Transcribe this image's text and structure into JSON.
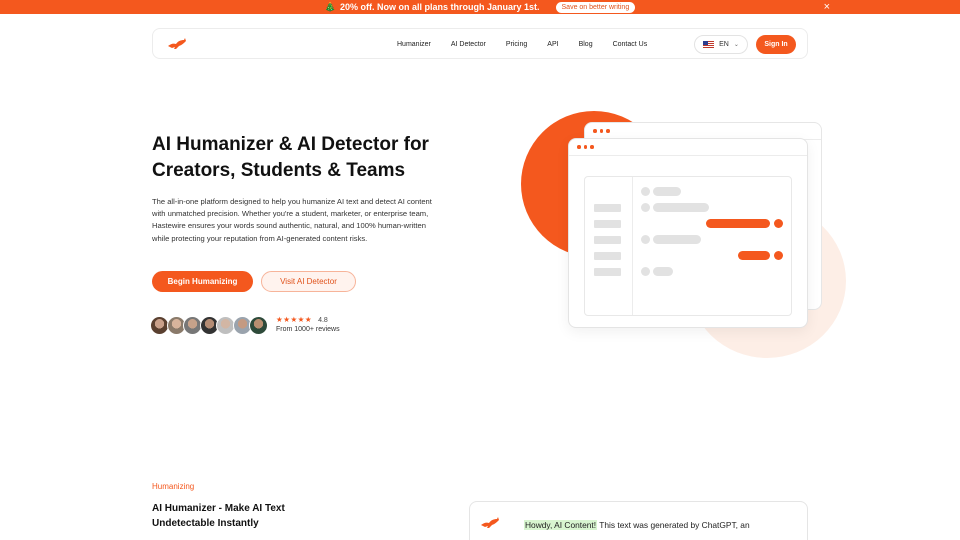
{
  "promo": {
    "icon": "gift-icon",
    "text": "20% off. Now on all plans through January 1st.",
    "cta": "Save on better writing",
    "close": "×"
  },
  "nav": {
    "logo": "hastewire-rabbit-logo",
    "links": [
      "Humanizer",
      "AI Detector",
      "Pricing",
      "API",
      "Blog",
      "Contact Us"
    ],
    "language": "EN",
    "signin": "Sign In"
  },
  "hero": {
    "title_line1": "AI Humanizer & AI Detector for",
    "title_line2": "Creators, Students & Teams",
    "description": "The all-in-one platform designed to help you humanize AI text and detect AI content with unmatched precision. Whether you're a student, marketer, or enterprise team, Hastewire ensures your words sound authentic, natural, and 100% human-written while protecting your reputation from AI-generated content risks.",
    "primary_cta": "Begin Humanizing",
    "secondary_cta": "Visit AI Detector",
    "rating": {
      "stars": "★★★★★",
      "score": "4.8",
      "reviews": "From 1000+ reviews"
    }
  },
  "section": {
    "label": "Humanizing",
    "title": "AI Humanizer - Make AI Text Undetectable Instantly",
    "demo_highlight": "Howdy, AI Content!",
    "demo_text": " This text was generated by ChatGPT, an"
  },
  "colors": {
    "accent": "#f4581e",
    "accent_light": "#fdeee6",
    "highlight": "#d8f5d0"
  }
}
